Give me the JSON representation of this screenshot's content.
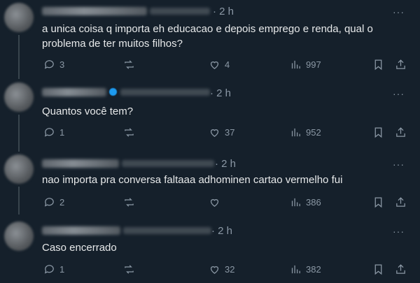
{
  "icons": {
    "reply": "reply-icon",
    "retweet": "retweet-icon",
    "like": "heart-icon",
    "views": "views-chart-icon",
    "bookmark": "bookmark-icon",
    "share": "share-icon",
    "more": "more-icon"
  },
  "more_glyph": "···",
  "colors": {
    "background": "#15202b",
    "text": "#e7e9ea",
    "muted": "#8b98a5",
    "verified": "#1d9bf0"
  },
  "tweets": [
    {
      "time": "· 2 h",
      "text": "a unica coisa q importa eh educacao e depois emprego e renda, qual o problema de ter muitos filhos?",
      "replies": "3",
      "retweets": "",
      "likes": "4",
      "views": "997"
    },
    {
      "time": "· 2 h",
      "text": "Quantos você tem?",
      "replies": "1",
      "retweets": "",
      "likes": "37",
      "views": "952"
    },
    {
      "time": "· 2 h",
      "text": "nao importa pra conversa faltaaa adhominen cartao vermelho fui",
      "replies": "2",
      "retweets": "",
      "likes": "",
      "views": "386"
    },
    {
      "time": "· 2 h",
      "text": "Caso encerrado",
      "replies": "1",
      "retweets": "",
      "likes": "32",
      "views": "382"
    }
  ]
}
